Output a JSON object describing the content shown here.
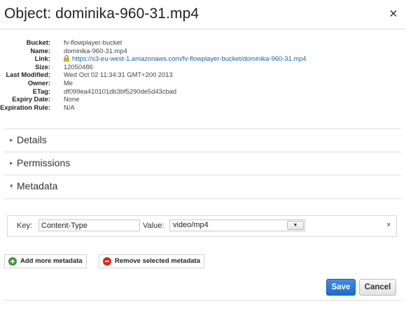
{
  "dialog": {
    "title": "Object: dominika-960-31.mp4",
    "close_label": "×"
  },
  "properties": [
    {
      "key": "Bucket:",
      "value": "fv-flowplayer-bucket"
    },
    {
      "key": "Name:",
      "value": "dominika-960-31.mp4"
    },
    {
      "key": "Link:",
      "value": "https://s3-eu-west-1.amazonaws.com/fv-flowplayer-bucket/dominika-960-31.mp4",
      "icon": "lock-icon"
    },
    {
      "key": "Size:",
      "value": "12050486"
    },
    {
      "key": "Last Modified:",
      "value": "Wed Oct 02 11:34:31 GMT+200 2013"
    },
    {
      "key": "Owner:",
      "value": "Me"
    },
    {
      "key": "ETag:",
      "value": "df099ea410101db3bf5290de5d43cbad"
    },
    {
      "key": "Expiry Date:",
      "value": "None"
    },
    {
      "key": "Expiration Rule:",
      "value": "N/A"
    }
  ],
  "sections": {
    "details": {
      "label": "Details",
      "arrow": "▸"
    },
    "permissions": {
      "label": "Permissions",
      "arrow": "▸"
    },
    "metadata": {
      "label": "Metadata",
      "arrow": "▾"
    }
  },
  "metadata_row": {
    "key_label": "Key:",
    "key_value": "Content-Type",
    "value_label": "Value:",
    "value_selected": "video/mp4",
    "dropdown_glyph": "▼",
    "remove_label": "×"
  },
  "actions": {
    "add_label": "Add more metadata",
    "remove_label": "Remove selected metadata",
    "save_label": "Save",
    "cancel_label": "Cancel"
  },
  "colors": {
    "link": "#1a5fa8",
    "save_button": "#2a78d4",
    "add_icon": "#3a9a2e",
    "remove_icon": "#d42b1f"
  }
}
